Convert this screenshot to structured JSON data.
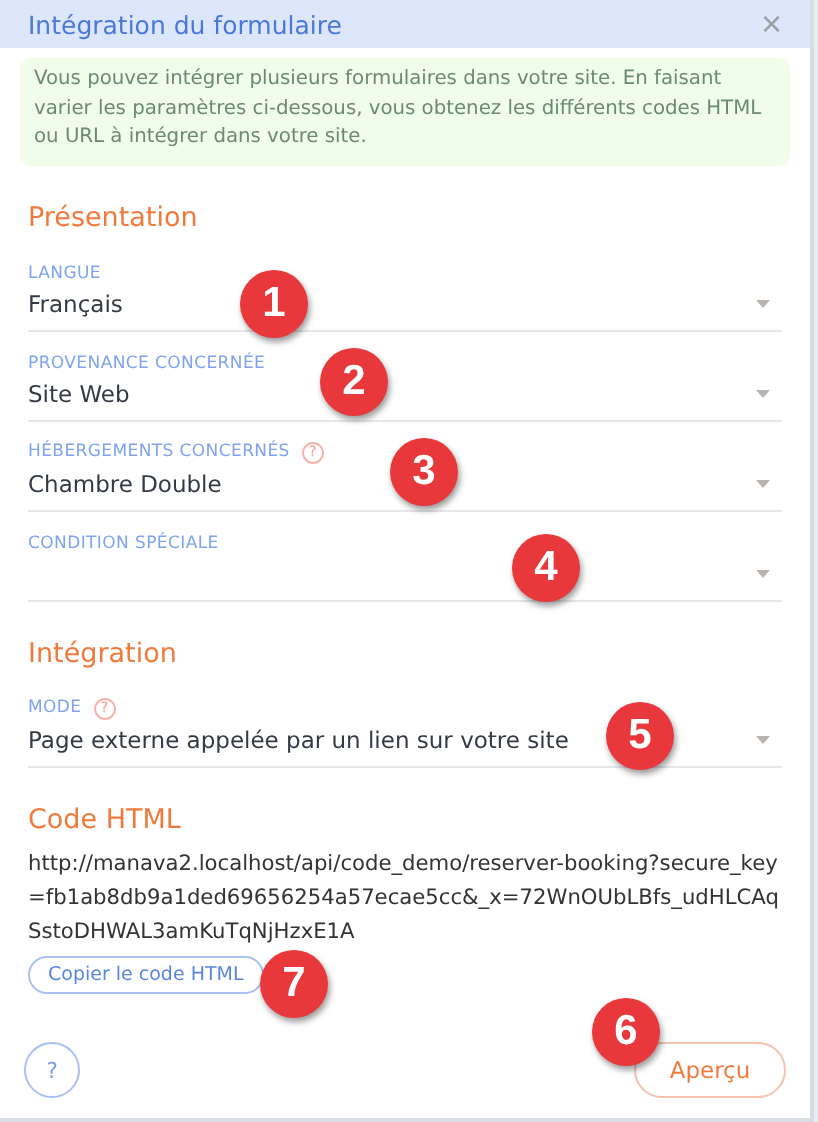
{
  "window": {
    "title": "Intégration du formulaire",
    "close": "×"
  },
  "info": "Vous pouvez intégrer plusieurs formulaires dans votre site. En faisant varier les paramètres ci-dessous, vous obtenez les différents codes HTML ou URL à intégrer dans votre site.",
  "sections": [
    {
      "title": "Présentation",
      "fields": [
        {
          "label": "LANGUE",
          "value": "Français"
        },
        {
          "label": "PROVENANCE CONCERNÉE",
          "value": "Site Web"
        },
        {
          "label": "HÉBERGEMENTS CONCERNÉS",
          "value": "Chambre Double",
          "help": "?"
        },
        {
          "label": "CONDITION SPÉCIALE"
        }
      ]
    },
    {
      "title": "Intégration",
      "fields": [
        {
          "label": "MODE",
          "value": "Page externe appelée par un lien sur votre site",
          "help": "?"
        }
      ]
    }
  ],
  "code": {
    "title": "Code HTML",
    "text": "http://manava2.localhost/api/code_demo/reserver-booking?secure_key=fb1ab8db9a1ded69656254a57ecae5cc&_x=72WnOUbLBfs_udHLCAqSstoDHWAL3amKuTqNjHzxE1A",
    "copy_button": "Copier le code HTML"
  },
  "footer": {
    "help_button": "?",
    "preview_button": "Aperçu"
  },
  "markers": [
    "1",
    "2",
    "3",
    "4",
    "5",
    "6",
    "7"
  ]
}
